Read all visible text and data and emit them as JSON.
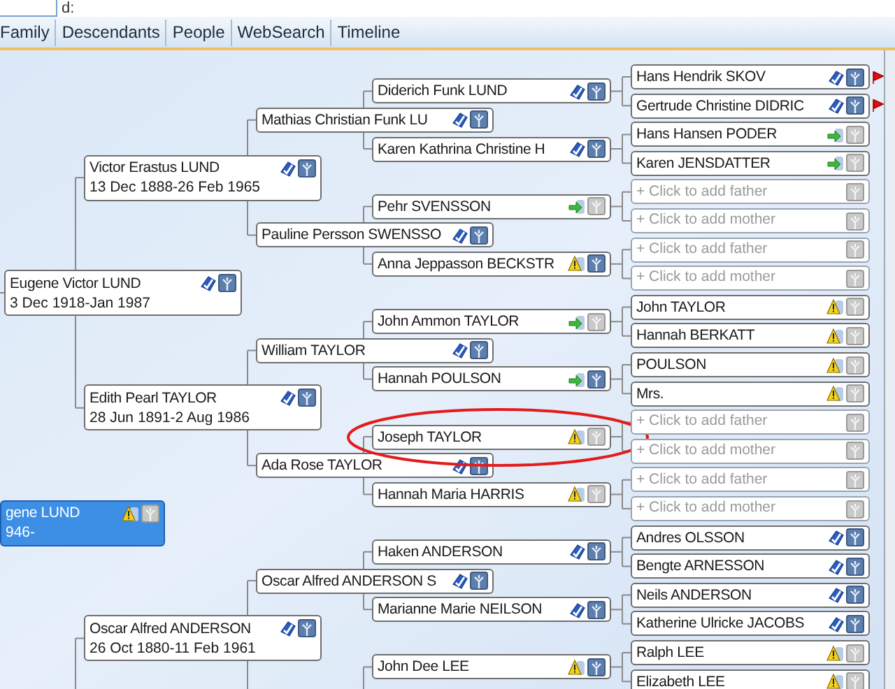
{
  "top_bar": {
    "label": "d:"
  },
  "tabs": [
    {
      "label": "Family"
    },
    {
      "label": "Descendants"
    },
    {
      "label": "People"
    },
    {
      "label": "WebSearch"
    },
    {
      "label": "Timeline"
    }
  ],
  "root": {
    "kind": "warning",
    "name": "gene LUND",
    "dates": "946-",
    "tree_filled": false,
    "selected": true,
    "father": {
      "kind": "checked",
      "name": "Eugene Victor LUND",
      "dates": "3 Dec 1918-Jan 1987",
      "tree_filled": true,
      "selected": false,
      "father": {
        "kind": "checked",
        "name": "Victor Erastus LUND",
        "dates": "13 Dec 1888-26 Feb 1965",
        "tree_filled": true,
        "selected": false,
        "father": {
          "kind": "checked",
          "name": "Mathias Christian Funk LU",
          "tree_filled": true,
          "selected": false,
          "father": {
            "kind": "checked",
            "name": "Diderich Funk LUND",
            "tree_filled": true,
            "selected": false,
            "father": {
              "kind": "checked",
              "name": "Hans Hendrik SKOV",
              "tree_filled": true,
              "selected": false,
              "flag": true
            },
            "mother": {
              "kind": "checked",
              "name": "Gertrude Christine DIDRIC",
              "tree_filled": true,
              "selected": false,
              "flag": true
            }
          },
          "mother": {
            "kind": "checked",
            "name": "Karen Kathrina Christine H",
            "tree_filled": true,
            "selected": false,
            "father": {
              "kind": "arrow",
              "name": "Hans Hansen PODER",
              "tree_filled": false,
              "selected": false
            },
            "mother": {
              "kind": "arrow",
              "name": "Karen JENSDATTER",
              "tree_filled": false,
              "selected": false
            }
          }
        },
        "mother": {
          "kind": "checked",
          "name": "Pauline Persson SWENSSO",
          "tree_filled": true,
          "selected": false,
          "father": {
            "kind": "arrow",
            "name": "Pehr SVENSSON",
            "tree_filled": false,
            "selected": false,
            "father": {
              "kind": "add",
              "label": "+ Click to add father"
            },
            "mother": {
              "kind": "add",
              "label": "+ Click to add mother"
            }
          },
          "mother": {
            "kind": "warning",
            "name": "Anna Jeppasson BECKSTR",
            "tree_filled": true,
            "selected": false,
            "father": {
              "kind": "add",
              "label": "+ Click to add father"
            },
            "mother": {
              "kind": "add",
              "label": "+ Click to add mother"
            }
          }
        }
      },
      "mother": {
        "kind": "checked",
        "name": "Edith Pearl TAYLOR",
        "dates": "28 Jun 1891-2 Aug 1986",
        "tree_filled": true,
        "selected": false,
        "father": {
          "kind": "checked",
          "name": "William TAYLOR",
          "tree_filled": true,
          "selected": false,
          "father": {
            "kind": "arrow",
            "name": "John Ammon TAYLOR",
            "tree_filled": false,
            "selected": false,
            "father": {
              "kind": "warning",
              "name": "John TAYLOR",
              "tree_filled": false,
              "selected": false
            },
            "mother": {
              "kind": "warning",
              "name": "Hannah BERKATT",
              "tree_filled": false,
              "selected": false
            }
          },
          "mother": {
            "kind": "arrow",
            "name": "Hannah POULSON",
            "tree_filled": true,
            "selected": false,
            "father": {
              "kind": "warning",
              "name": "POULSON",
              "tree_filled": false,
              "selected": false
            },
            "mother": {
              "kind": "warning",
              "name": "Mrs.",
              "tree_filled": false,
              "selected": false
            }
          }
        },
        "mother": {
          "kind": "checked",
          "name": "Ada Rose TAYLOR",
          "tree_filled": true,
          "selected": false,
          "father": {
            "kind": "warning",
            "name": "Joseph TAYLOR",
            "tree_filled": false,
            "selected": false,
            "circled": true,
            "father": {
              "kind": "add",
              "label": "+ Click to add father"
            },
            "mother": {
              "kind": "add",
              "label": "+ Click to add mother"
            }
          },
          "mother": {
            "kind": "warning",
            "name": "Hannah Maria HARRIS",
            "tree_filled": false,
            "selected": false,
            "father": {
              "kind": "add",
              "label": "+ Click to add father"
            },
            "mother": {
              "kind": "add",
              "label": "+ Click to add mother"
            }
          }
        }
      }
    },
    "mother": {
      "father": {
        "kind": "checked",
        "name": "Oscar Alfred ANDERSON",
        "dates": "26 Oct 1880-11 Feb 1961",
        "tree_filled": true,
        "selected": false,
        "father": {
          "kind": "checked",
          "name": "Oscar Alfred ANDERSON S",
          "tree_filled": true,
          "selected": false,
          "father": {
            "kind": "checked",
            "name": "Haken ANDERSON",
            "tree_filled": true,
            "selected": false,
            "father": {
              "kind": "checked",
              "name": "Andres OLSSON",
              "tree_filled": true,
              "selected": false
            },
            "mother": {
              "kind": "checked",
              "name": "Bengte ARNESSON",
              "tree_filled": true,
              "selected": false
            }
          },
          "mother": {
            "kind": "checked",
            "name": "Marianne Marie NEILSON",
            "tree_filled": true,
            "selected": false,
            "father": {
              "kind": "checked",
              "name": "Neils ANDERSON",
              "tree_filled": true,
              "selected": false
            },
            "mother": {
              "kind": "checked",
              "name": "Katherine Ulricke JACOBS",
              "tree_filled": true,
              "selected": false
            }
          }
        },
        "mother": {
          "father": {
            "kind": "warning",
            "name": "John Dee LEE",
            "tree_filled": true,
            "selected": false,
            "father": {
              "kind": "warning",
              "name": "Ralph LEE",
              "tree_filled": false,
              "selected": false
            },
            "mother": {
              "kind": "warning",
              "name": "Elizabeth LEE",
              "tree_filled": false,
              "selected": false
            }
          }
        }
      }
    }
  }
}
